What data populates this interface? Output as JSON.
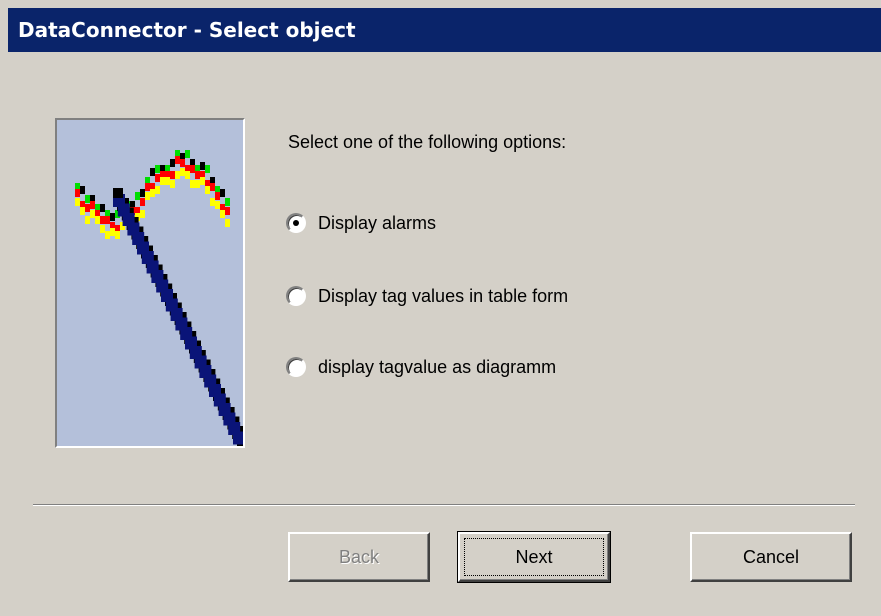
{
  "window": {
    "title": "DataConnector - Select object"
  },
  "colors": {
    "titlebar": "#0a246a",
    "background": "#d4d0c8",
    "image_bg": "#b4c0da"
  },
  "wizard_image": {
    "icon": "wand-with-signal-icon"
  },
  "content": {
    "prompt": "Select one of the following options:",
    "options": [
      {
        "label": "Display alarms",
        "checked": true
      },
      {
        "label": "Display tag values in table form",
        "checked": false
      },
      {
        "label": "display tagvalue as diagramm",
        "checked": false
      }
    ]
  },
  "buttons": {
    "back": {
      "label": "Back",
      "enabled": false
    },
    "next": {
      "label": "Next",
      "enabled": true,
      "default": true
    },
    "cancel": {
      "label": "Cancel",
      "enabled": true
    }
  }
}
